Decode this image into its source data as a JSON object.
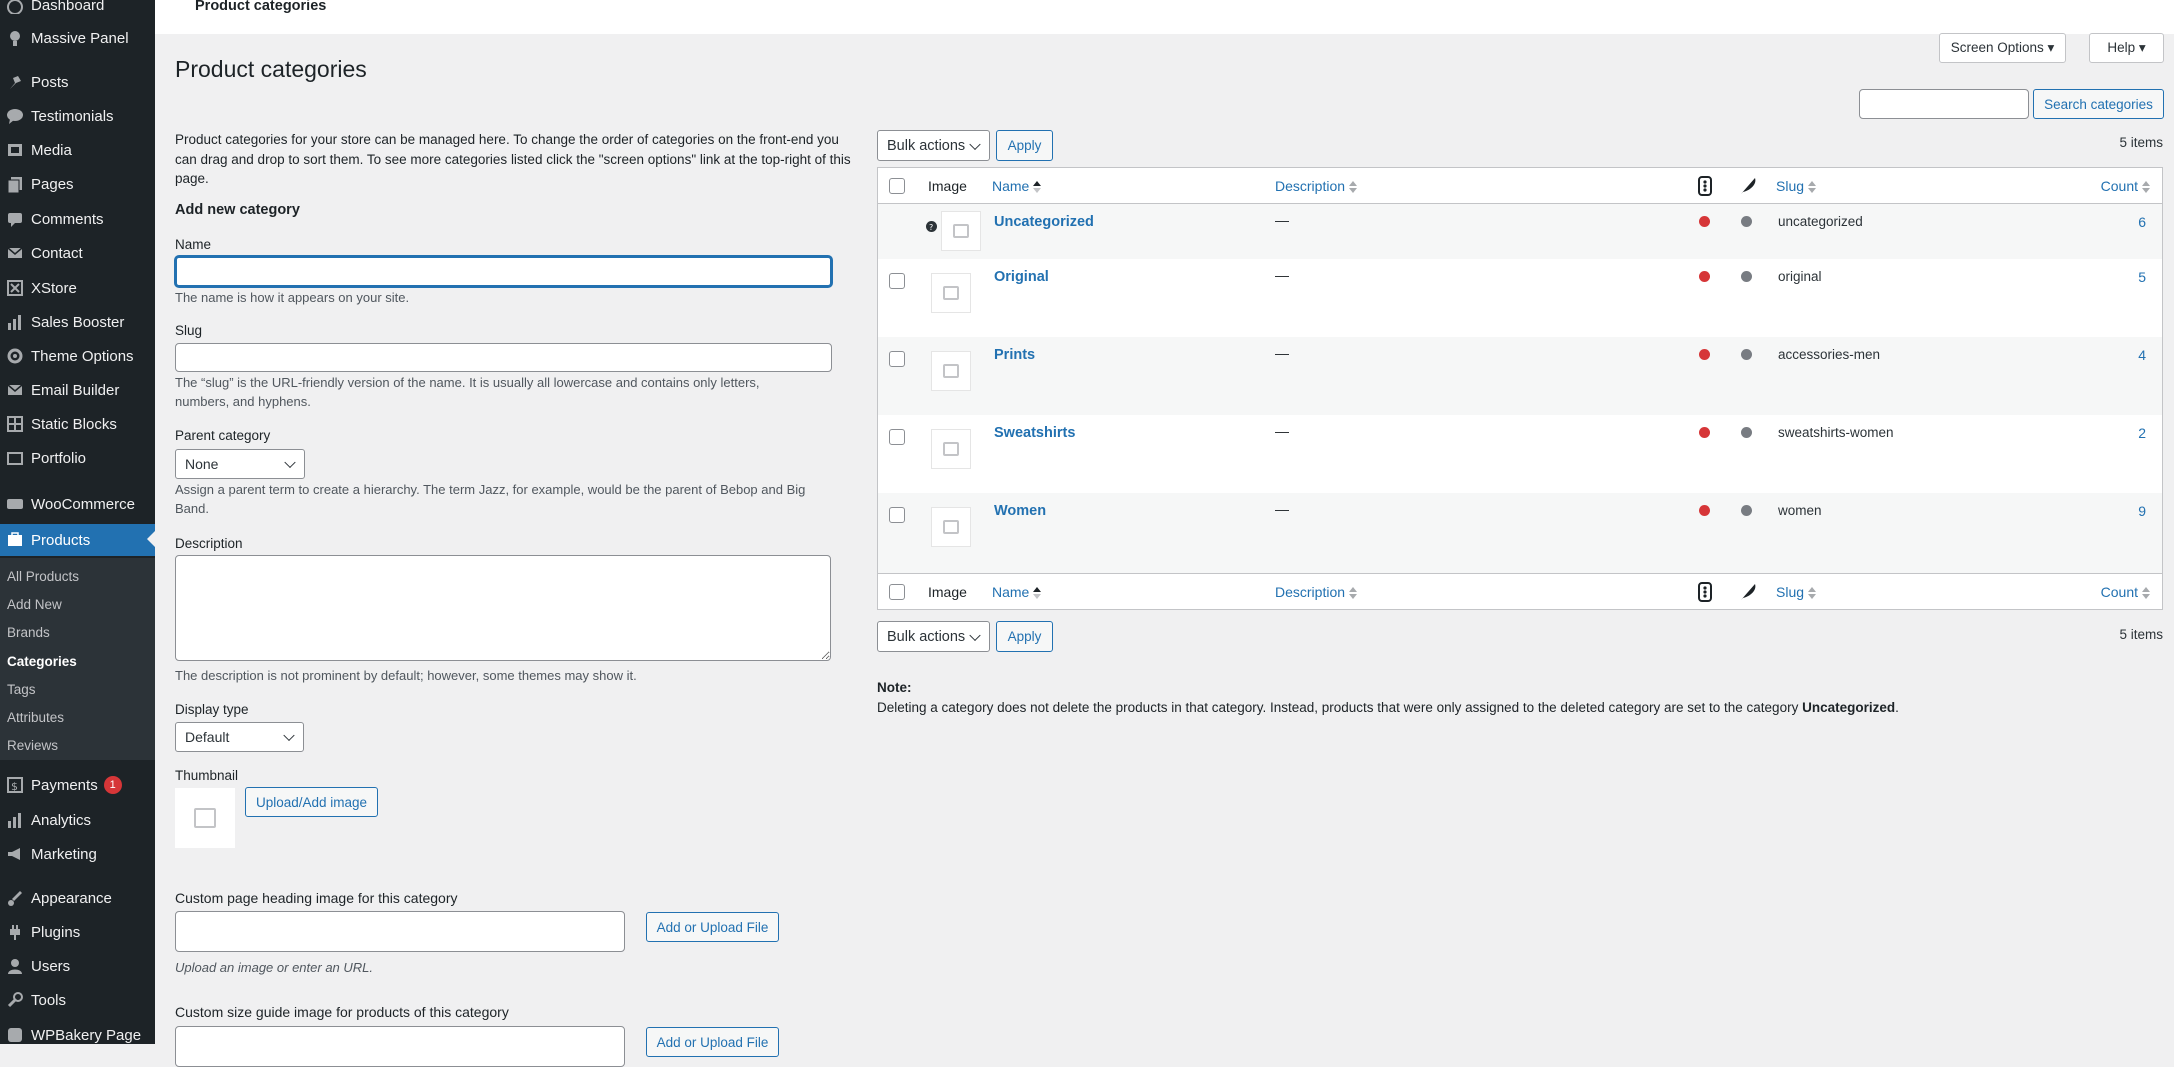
{
  "sidebar": {
    "items": [
      {
        "label": "Dashboard",
        "icon": "dashboard-icon"
      },
      {
        "label": "Massive Panel",
        "icon": "lightbulb-icon"
      },
      {
        "label": "Posts",
        "icon": "pin-icon"
      },
      {
        "label": "Testimonials",
        "icon": "speech-bubble-icon"
      },
      {
        "label": "Media",
        "icon": "media-icon"
      },
      {
        "label": "Pages",
        "icon": "pages-icon"
      },
      {
        "label": "Comments",
        "icon": "comment-icon"
      },
      {
        "label": "Contact",
        "icon": "envelope-icon"
      },
      {
        "label": "XStore",
        "icon": "xstore-icon"
      },
      {
        "label": "Sales Booster",
        "icon": "bar-chart-icon"
      },
      {
        "label": "Theme Options",
        "icon": "gear-icon"
      },
      {
        "label": "Email Builder",
        "icon": "envelope-icon"
      },
      {
        "label": "Static Blocks",
        "icon": "blocks-icon"
      },
      {
        "label": "Portfolio",
        "icon": "portfolio-icon"
      },
      {
        "label": "WooCommerce",
        "icon": "woocommerce-icon"
      },
      {
        "label": "Products",
        "icon": "products-icon"
      },
      {
        "label": "Payments",
        "icon": "payments-icon",
        "badge": "1"
      },
      {
        "label": "Analytics",
        "icon": "bar-chart-icon"
      },
      {
        "label": "Marketing",
        "icon": "megaphone-icon"
      },
      {
        "label": "Appearance",
        "icon": "brush-icon"
      },
      {
        "label": "Plugins",
        "icon": "plug-icon"
      },
      {
        "label": "Users",
        "icon": "user-icon"
      },
      {
        "label": "Tools",
        "icon": "wrench-icon"
      },
      {
        "label": "WPBakery Page",
        "icon": "wpbakery-icon"
      }
    ],
    "submenu": [
      "All Products",
      "Add New",
      "Brands",
      "Categories",
      "Tags",
      "Attributes",
      "Reviews"
    ],
    "current_submenu": "Categories"
  },
  "topbar": {
    "crumb": "Product categories",
    "screen_options": "Screen Options ▾",
    "help": "Help ▾"
  },
  "page": {
    "title": "Product categories"
  },
  "form": {
    "intro": "Product categories for your store can be managed here. To change the order of categories on the front-end you can drag and drop to sort them. To see more categories listed click the \"screen options\" link at the top-right of this page.",
    "heading": "Add new category",
    "name_label": "Name",
    "name_value": "",
    "name_help": "The name is how it appears on your site.",
    "slug_label": "Slug",
    "slug_value": "",
    "slug_help": "The “slug” is the URL-friendly version of the name. It is usually all lowercase and contains only letters, numbers, and hyphens.",
    "parent_label": "Parent category",
    "parent_value": "None",
    "parent_help": "Assign a parent term to create a hierarchy. The term Jazz, for example, would be the parent of Bebop and Big Band.",
    "description_label": "Description",
    "description_value": "",
    "description_help": "The description is not prominent by default; however, some themes may show it.",
    "display_type_label": "Display type",
    "display_type_value": "Default",
    "thumbnail_label": "Thumbnail",
    "upload_button": "Upload/Add image",
    "heading_image_label": "Custom page heading image for this category",
    "heading_image_value": "",
    "add_upload_button": "Add or Upload File",
    "heading_image_help": "Upload an image or enter an URL.",
    "size_guide_label": "Custom size guide image for products of this category",
    "size_guide_value": "",
    "size_guide_button": "Add or Upload File"
  },
  "list": {
    "search_value": "",
    "search_button": "Search categories",
    "bulk_actions": "Bulk actions",
    "apply": "Apply",
    "items_count": "5 items",
    "columns": {
      "image": "Image",
      "name": "Name",
      "description": "Description",
      "slug": "Slug",
      "count": "Count"
    },
    "rows": [
      {
        "name": "Uncategorized",
        "description": "—",
        "slug": "uncategorized",
        "count": "6"
      },
      {
        "name": "Original",
        "description": "—",
        "slug": "original",
        "count": "5"
      },
      {
        "name": "Prints",
        "description": "—",
        "slug": "accessories-men",
        "count": "4"
      },
      {
        "name": "Sweatshirts",
        "description": "—",
        "slug": "sweatshirts-women",
        "count": "2"
      },
      {
        "name": "Women",
        "description": "—",
        "slug": "women",
        "count": "9"
      }
    ],
    "status_colors": {
      "seo": "#d63638",
      "readability": "#787c82"
    }
  },
  "note": {
    "title": "Note:",
    "text": "Deleting a category does not delete the products in that category. Instead, products that were only assigned to the deleted category are set to the category",
    "strong": "Uncategorized",
    "end": "."
  }
}
